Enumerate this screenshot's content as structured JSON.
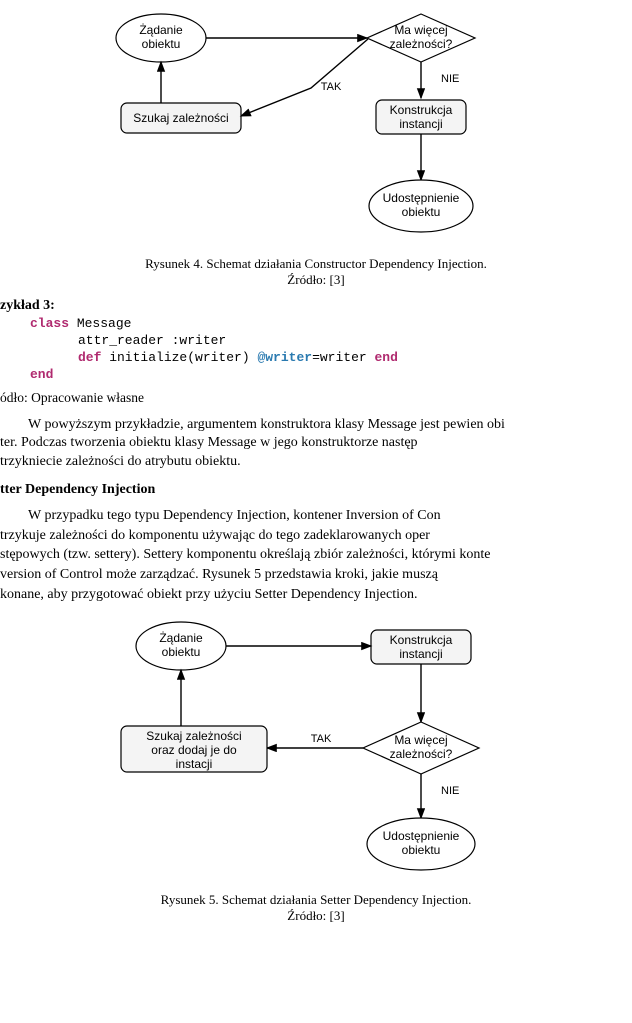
{
  "figure1": {
    "node_request": "Żądanie\nobiektu",
    "node_deps_q": "Ma więcej\nzależności?",
    "edge_yes": "TAK",
    "edge_no": "NIE",
    "node_search": "Szukaj zależności",
    "node_construct": "Konstrukcja\ninstancji",
    "node_release": "Udostępnienie\nobiektu",
    "caption": "Rysunek 4. Schemat działania Constructor Dependency Injection.",
    "source": "Źródło: [3]"
  },
  "example": {
    "title": "zykład 3:",
    "line1_kw": "class",
    "line1_rest": " Message",
    "line2": "attr_reader :writer",
    "line3_def": "def",
    "line3_mid": " initialize(writer)",
    "line3_sp": "@writer",
    "line3_eq": "=writer",
    "line3_end": "end",
    "line4_end": "end"
  },
  "text": {
    "own_source": "ódło: Opracowanie własne",
    "para1": "W powyższym przykładzie, argumentem konstruktora klasy Message jest pewien obiter. Podczas tworzenia obiektu klasy Message w jego konstruktorze następrzykniеcie zależności do atrybutu obiektu.",
    "para1_l1": "W powyższym przykładzie, argumentem konstruktora klasy Message jest pewien obi",
    "para1_l2": "ter.  Podczas  tworzenia  obiektu  klasy  Message  w  jego  konstruktorze  następ",
    "para1_l3": "trzykniеcie zależności do atrybutu obiektu.",
    "setter_heading": "tter Dependency Injection",
    "para2_l1": "W  przypadku  tego  typu  Dependency  Injection,  kontener  Inversion  of  Con",
    "para2_l2": "trzykuje  zależności  do  komponentu  używając  do  tego  zadeklarowanych  oper",
    "para2_l3": "stępowych (tzw. settery). Settery komponentu określają zbiór zależności, którymi konte",
    "para2_l4": "version  of  Control  może  zarządzać.  Rysunek  5  przedstawia  kroki,  jakie  muszą",
    "para2_l5": "konane, aby przygotować obiekt przy użyciu Setter Dependency Injection."
  },
  "figure2": {
    "node_request": "Żądanie\nobiektu",
    "node_construct": "Konstrukcja\ninstancji",
    "node_search": "Szukaj zależności\noraz dodaj je do\ninstacji",
    "node_deps_q": "Ma więcej\nzależności?",
    "edge_yes": "TAK",
    "edge_no": "NIE",
    "node_release": "Udostępnienie\nobiektu",
    "caption": "Rysunek 5. Schemat działania Setter Dependency Injection.",
    "source": "Źródło: [3]"
  }
}
